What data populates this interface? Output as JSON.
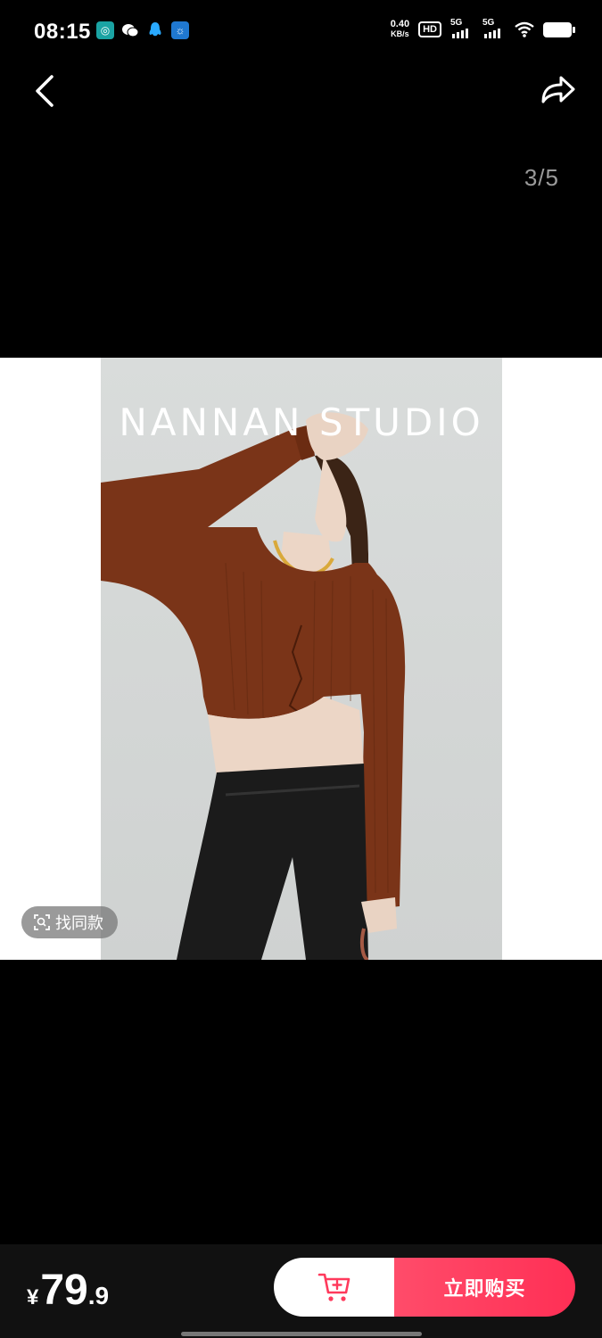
{
  "status_bar": {
    "time": "08:15",
    "net_speed_value": "0.40",
    "net_speed_unit": "KB/s",
    "hd_label": "HD",
    "signal_1": "5G",
    "signal_2": "5G"
  },
  "nav": {
    "back_icon": "chevron-left-icon",
    "share_icon": "share-arrow-icon"
  },
  "gallery": {
    "counter": "3/5",
    "brand_text": "NANNAN STUDIO",
    "find_similar_label": "找同款"
  },
  "bottom_bar": {
    "currency": "¥",
    "price_integer": "79",
    "price_decimal": ".9",
    "cart_icon": "add-to-cart-icon",
    "buy_label": "立即购买",
    "buy_color": "#ff3a5c"
  }
}
